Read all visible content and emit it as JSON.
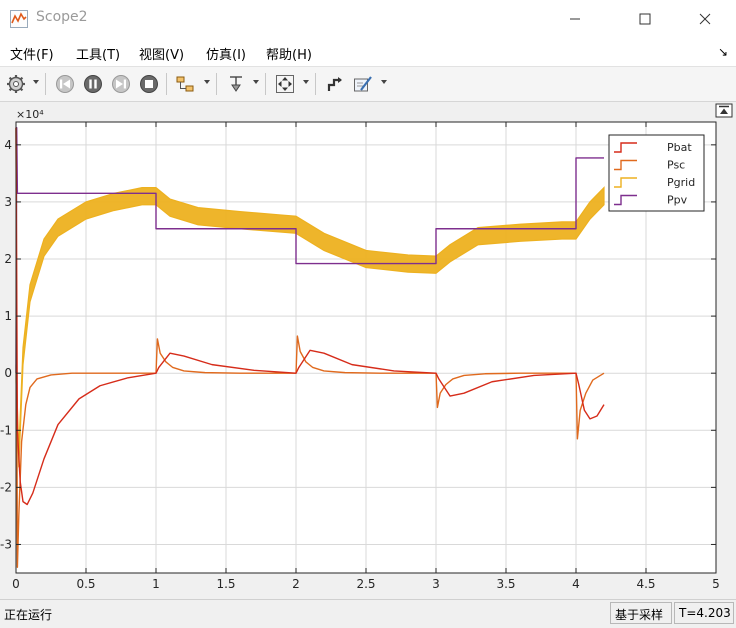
{
  "window": {
    "title": "Scope2"
  },
  "menu": [
    "文件(F)",
    "工具(T)",
    "视图(V)",
    "仿真(I)",
    "帮助(H)"
  ],
  "menu_pin_glyph": "↘",
  "toolbar_icons": [
    "gear-icon",
    "step-back-icon",
    "pause-icon",
    "step-forward-icon",
    "stop-icon",
    "highlight-block-icon",
    "cursor-measure-icon",
    "zoom-fit-icon",
    "style-icon",
    "legend-edit-icon"
  ],
  "colors": {
    "Pbat": "#d62c1a",
    "Psc": "#e06a1e",
    "Pgrid": "#edb120",
    "Ppv": "#7e2f8e"
  },
  "chart_data": {
    "type": "line",
    "exponent_label": "×10⁴",
    "xlim": [
      0,
      5
    ],
    "ylim": [
      -3.5,
      4.4
    ],
    "x_ticks": [
      "0",
      "0.5",
      "1",
      "1.5",
      "2",
      "2.5",
      "3",
      "3.5",
      "4",
      "4.5",
      "5"
    ],
    "y_ticks": [
      "-3",
      "-2",
      "-1",
      "0",
      "1",
      "2",
      "3",
      "4"
    ],
    "grid": true,
    "legend_position": "top-right",
    "series": [
      {
        "name": "Pbat",
        "x": [
          0,
          0.01,
          0.03,
          0.05,
          0.08,
          0.12,
          0.2,
          0.3,
          0.45,
          0.6,
          0.8,
          1.0,
          1.02,
          1.1,
          1.2,
          1.4,
          1.7,
          2.0,
          2.02,
          2.1,
          2.2,
          2.4,
          2.7,
          3.0,
          3.02,
          3.1,
          3.2,
          3.4,
          3.7,
          4.0,
          4.02,
          4.06,
          4.1,
          4.15,
          4.2
        ],
        "y": [
          4.3,
          -1.0,
          -1.9,
          -2.25,
          -2.3,
          -2.1,
          -1.5,
          -0.9,
          -0.45,
          -0.22,
          -0.08,
          0.0,
          0.1,
          0.35,
          0.3,
          0.15,
          0.05,
          0.0,
          0.1,
          0.4,
          0.35,
          0.15,
          0.04,
          0.0,
          -0.1,
          -0.4,
          -0.35,
          -0.15,
          -0.04,
          0.0,
          -0.2,
          -0.65,
          -0.8,
          -0.75,
          -0.55
        ]
      },
      {
        "name": "Psc",
        "x": [
          0,
          0.01,
          0.02,
          0.04,
          0.07,
          0.1,
          0.15,
          0.25,
          0.4,
          0.6,
          1.0,
          1.01,
          1.03,
          1.07,
          1.12,
          1.2,
          1.35,
          1.6,
          2.0,
          2.01,
          2.03,
          2.07,
          2.12,
          2.2,
          2.35,
          2.6,
          3.0,
          3.01,
          3.03,
          3.07,
          3.12,
          3.2,
          3.35,
          3.6,
          4.0,
          4.01,
          4.03,
          4.07,
          4.12,
          4.2
        ],
        "y": [
          4.3,
          -3.4,
          -2.5,
          -1.2,
          -0.55,
          -0.25,
          -0.1,
          -0.03,
          0.0,
          0.0,
          0.0,
          0.6,
          0.35,
          0.2,
          0.1,
          0.04,
          0.01,
          0.0,
          0.0,
          0.65,
          0.38,
          0.2,
          0.1,
          0.04,
          0.01,
          0.0,
          0.0,
          -0.6,
          -0.35,
          -0.2,
          -0.1,
          -0.04,
          -0.01,
          0.0,
          0.0,
          -1.15,
          -0.65,
          -0.35,
          -0.12,
          0.0
        ]
      },
      {
        "name": "Pgrid",
        "x": [
          0,
          0.02,
          0.05,
          0.1,
          0.2,
          0.3,
          0.5,
          0.7,
          0.9,
          1.0,
          1.1,
          1.3,
          1.6,
          1.9,
          2.0,
          2.2,
          2.5,
          2.8,
          3.0,
          3.1,
          3.3,
          3.6,
          3.9,
          4.0,
          4.1,
          4.2
        ],
        "y": [
          0.0,
          -1.5,
          0.3,
          1.4,
          2.2,
          2.55,
          2.85,
          3.0,
          3.1,
          3.1,
          2.9,
          2.75,
          2.68,
          2.62,
          2.6,
          2.3,
          2.0,
          1.92,
          1.9,
          2.1,
          2.4,
          2.46,
          2.5,
          2.5,
          2.85,
          3.1
        ],
        "band": 0.15
      },
      {
        "name": "Ppv",
        "x": [
          0,
          0.005,
          0.01,
          1.0,
          1.0,
          2.0,
          2.0,
          3.0,
          3.0,
          4.0,
          4.0,
          4.2
        ],
        "y": [
          0.0,
          4.3,
          3.15,
          3.15,
          2.53,
          2.53,
          1.92,
          1.92,
          2.53,
          2.53,
          3.77,
          3.77
        ]
      }
    ]
  },
  "status": {
    "left": "正在运行",
    "mode": "基于采样",
    "time": "T=4.203"
  }
}
